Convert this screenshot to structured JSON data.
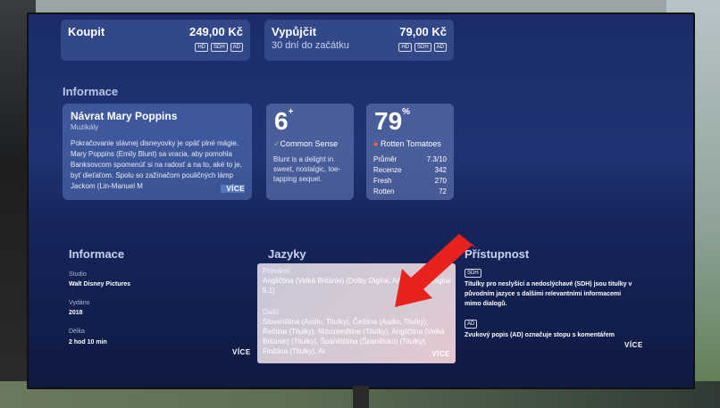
{
  "purchase": {
    "buy": {
      "label": "Koupit",
      "price": "249,00 Kč",
      "badges": [
        "HD",
        "SDH",
        "AD"
      ]
    },
    "rent": {
      "label": "Vypůjčit",
      "sub": "30 dní do začátku",
      "price": "79,00 Kč",
      "badges": [
        "HD",
        "SDH",
        "AD"
      ]
    }
  },
  "info_section": {
    "title": "Informace",
    "movie": {
      "title": "Návrat Mary Poppins",
      "genre": "Muzikály",
      "description": "Pokračovanie slávnej disneyovky je opäť plné mágie. Mary Poppins (Emily Blunt) sa vracia, aby pomohla Banksovcom spomenúť si na radosť a na to, aké to je, byť dieťaťom. Spolu so zažínačom pouličných lámp Jackom (Lin-Manuel M",
      "more": "VÍCE"
    },
    "common_sense": {
      "age": "6",
      "age_suffix": "+",
      "label": "Common Sense",
      "quote": "Blunt is a delight in sweet, nostalgic, toe-tapping sequel."
    },
    "rotten_tomatoes": {
      "score": "79",
      "score_suffix": "%",
      "label": "Rotten Tomatoes",
      "rows": [
        {
          "k": "Průměr",
          "v": "7.3/10"
        },
        {
          "k": "Recenze",
          "v": "342"
        },
        {
          "k": "Fresh",
          "v": "270"
        },
        {
          "k": "Rotten",
          "v": "72"
        }
      ]
    }
  },
  "details": {
    "title": "Informace",
    "studio_label": "Studio",
    "studio": "Walt Disney Pictures",
    "released_label": "Vydáno",
    "released": "2018",
    "length_label": "Délka",
    "length": "2 hod 10 min",
    "more": "VÍCE"
  },
  "languages": {
    "title": "Jazyky",
    "primary_label": "Primární",
    "primary": "Angličtina (Velká Británie) (Dolby Digital, AAC, Dolby Digital 5.1)",
    "other_label": "Další",
    "other": "Slovenština (Audio, Titulky), Čeština (Audio, Titulky), Řečtina (Titulky), Nizozemština (Titulky), Angličtina (Velká Británie) (Titulky), Španělština (Španělsko) (Titulky), Finština (Titulky), Ar",
    "more": "VÍCE"
  },
  "accessibility": {
    "title": "Přístupnost",
    "sdh_badge": "SDH",
    "sdh_text": "Titulky pro neslyšící a nedoslýchavé (SDH) jsou titulky v původním jazyce s dalšími relevantními informacemi mimo dialogů.",
    "ad_badge": "AD",
    "ad_text": "Zvukový popis (AD) označuje stopu s komentářem",
    "more": "VÍCE"
  },
  "colors": {
    "arrow": "#e8221c",
    "screen": "#1f3374",
    "focus": "#d9c9d4"
  }
}
